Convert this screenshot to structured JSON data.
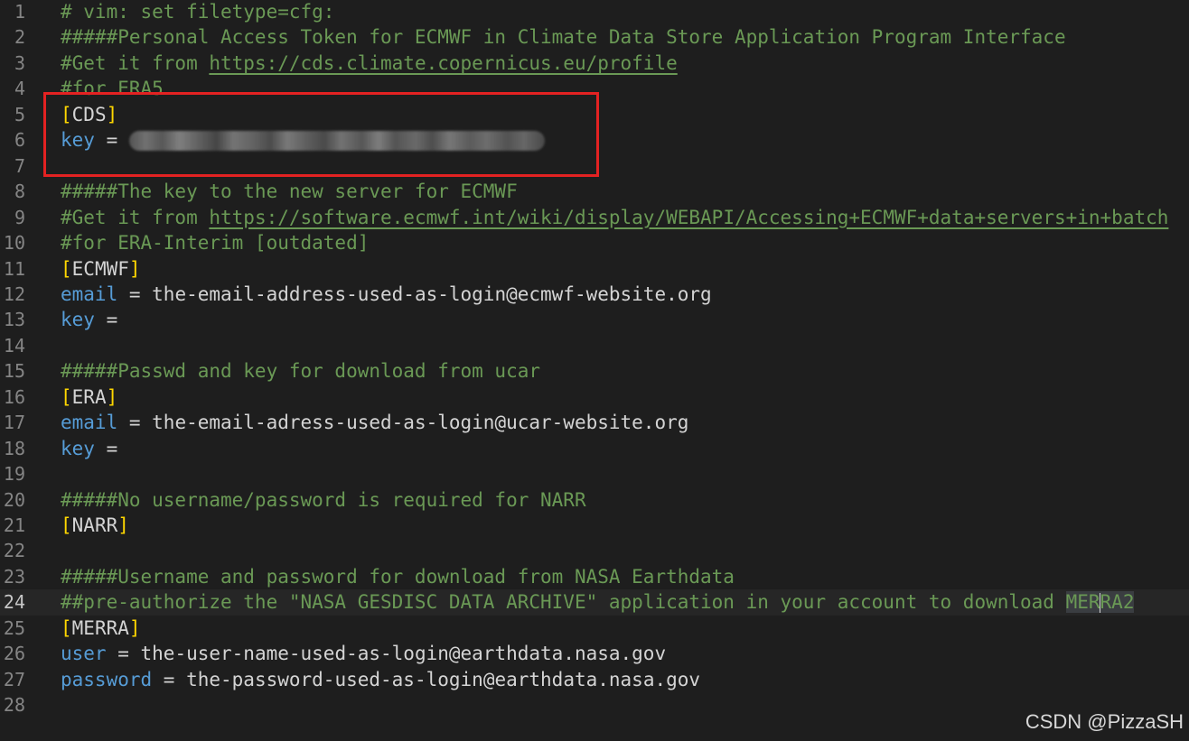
{
  "editor": {
    "lines": [
      {
        "num": "1",
        "comment": "# vim: set filetype=cfg:"
      },
      {
        "num": "2",
        "comment": "#####Personal Access Token for ECMWF in Climate Data Store Application Program Interface"
      },
      {
        "num": "3",
        "comment_prefix": "#Get it from ",
        "link": "https://cds.climate.copernicus.eu/profile"
      },
      {
        "num": "4",
        "comment": "#for ERA5"
      },
      {
        "num": "5",
        "section": "CDS"
      },
      {
        "num": "6",
        "key": "key",
        "op": " = "
      },
      {
        "num": "7"
      },
      {
        "num": "8",
        "comment": "#####The key to the new server for ECMWF"
      },
      {
        "num": "9",
        "comment_prefix": "#Get it from ",
        "link": "https://software.ecmwf.int/wiki/display/WEBAPI/Accessing+ECMWF+data+servers+in+batch"
      },
      {
        "num": "10",
        "comment": "#for ERA-Interim [outdated]"
      },
      {
        "num": "11",
        "section": "ECMWF"
      },
      {
        "num": "12",
        "key": "email",
        "op": " = ",
        "value": "the-email-address-used-as-login@ecmwf-website.org"
      },
      {
        "num": "13",
        "key": "key",
        "op": " ="
      },
      {
        "num": "14"
      },
      {
        "num": "15",
        "comment": "#####Passwd and key for download from ucar"
      },
      {
        "num": "16",
        "section": "ERA"
      },
      {
        "num": "17",
        "key": "email",
        "op": " = ",
        "value": "the-email-adress-used-as-login@ucar-website.org"
      },
      {
        "num": "18",
        "key": "key",
        "op": " ="
      },
      {
        "num": "19"
      },
      {
        "num": "20",
        "comment": "#####No username/password is required for NARR"
      },
      {
        "num": "21",
        "section": "NARR"
      },
      {
        "num": "22"
      },
      {
        "num": "23",
        "comment": "#####Username and password for download from NASA Earthdata"
      },
      {
        "num": "24",
        "comment_prefix": "##pre-authorize the \"NASA GESDISC DATA ARCHIVE\" application in your account to download ",
        "highlight_a": "MER",
        "highlight_b": "RA2"
      },
      {
        "num": "25",
        "section": "MERRA"
      },
      {
        "num": "26",
        "key": "user",
        "op": " = ",
        "value": "the-user-name-used-as-login@earthdata.nasa.gov"
      },
      {
        "num": "27",
        "key": "password",
        "op": " = ",
        "value": "the-password-used-as-login@earthdata.nasa.gov"
      },
      {
        "num": "28"
      }
    ],
    "current_line": "24"
  },
  "watermark": "CSDN @PizzaSH",
  "colors": {
    "background": "#1e1e1e",
    "comment": "#6a9955",
    "key": "#569cd6",
    "bracket": "#ffd700",
    "annotation_box": "#e32222"
  }
}
